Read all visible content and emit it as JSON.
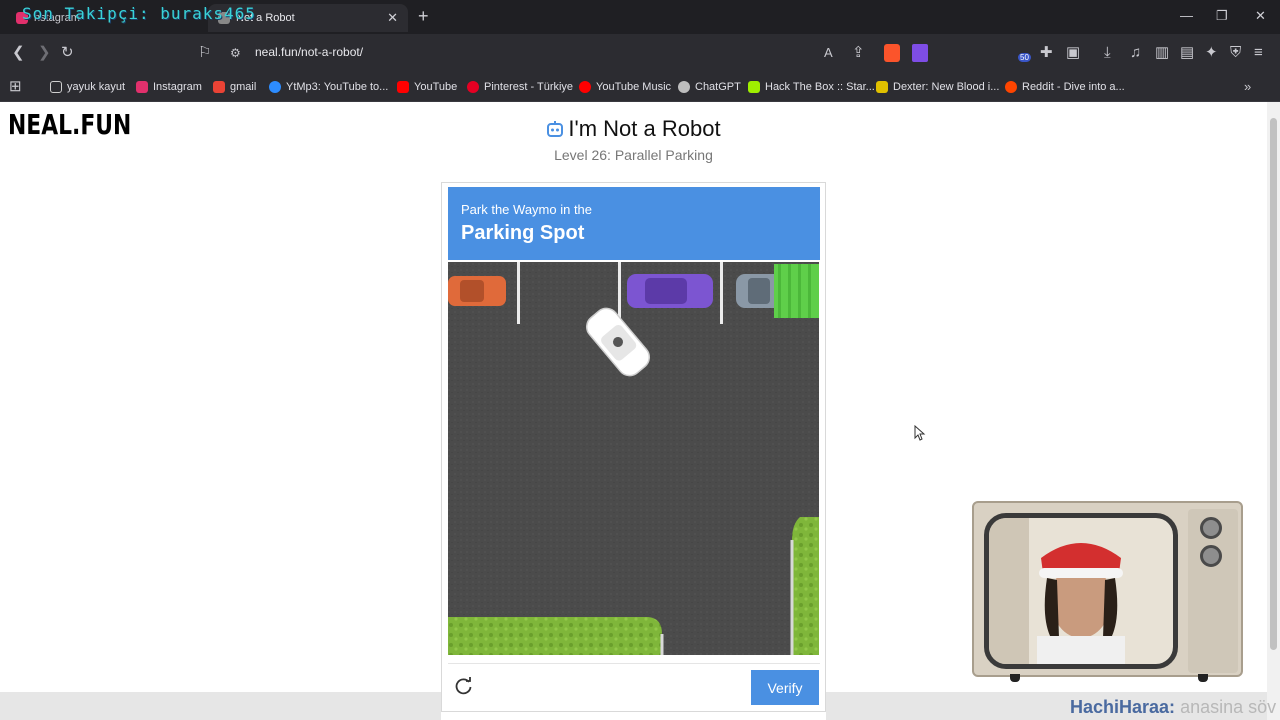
{
  "browser": {
    "tabs": [
      {
        "label": "nstagram",
        "active": false
      },
      {
        "label": "Not a Robot",
        "active": true
      }
    ],
    "overlay_text": "Son Takipçi: buraks465",
    "url": "neal.fun/not-a-robot/",
    "bookmarks": [
      {
        "label": "yayuk kayut",
        "color": "#cfcfcf"
      },
      {
        "label": "Instagram",
        "color": "#e1306c"
      },
      {
        "label": "gmail",
        "color": "#ea4335"
      },
      {
        "label": "YtMp3: YouTube to...",
        "color": "#2d8cff"
      },
      {
        "label": "YouTube",
        "color": "#ff0000"
      },
      {
        "label": "Pinterest - Türkiye",
        "color": "#e60023"
      },
      {
        "label": "YouTube Music",
        "color": "#ff0000"
      },
      {
        "label": "ChatGPT",
        "color": "#bdbdbd"
      },
      {
        "label": "Hack The Box :: Star...",
        "color": "#9fef00"
      },
      {
        "label": "Dexter: New Blood i...",
        "color": "#e0c000"
      },
      {
        "label": "Reddit - Dive into a...",
        "color": "#ff4500"
      }
    ],
    "badge_count": "50"
  },
  "page": {
    "logo": "NEAL.FUN",
    "title": "I'm Not a Robot",
    "subtitle": "Level 26: Parallel Parking"
  },
  "captcha": {
    "instruction": "Park the Waymo in the",
    "target": "Parking Spot",
    "verify_label": "Verify"
  },
  "stream": {
    "name": "HachiHaraa:",
    "message": "anasina söv"
  },
  "colors": {
    "accent": "#4a90e2",
    "asphalt": "#4b4b4b",
    "grass": "#7fb63a",
    "parking_spot": "#5fcf4a"
  }
}
